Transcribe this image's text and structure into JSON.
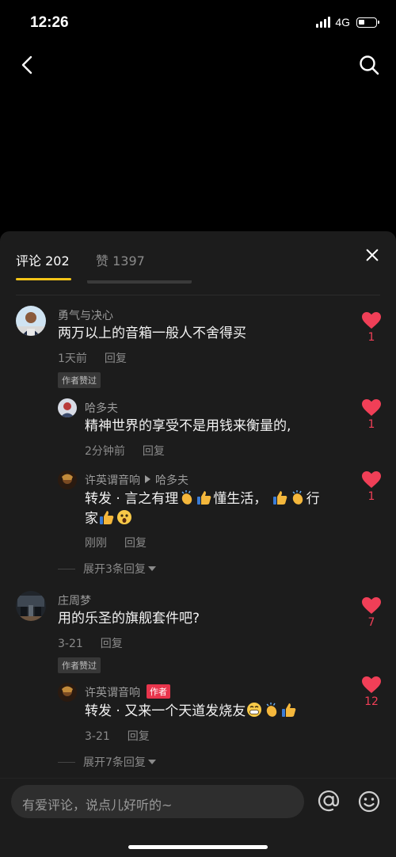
{
  "status_bar": {
    "time": "12:26",
    "network": "4G"
  },
  "panel": {
    "tabs": {
      "comments": "评论 202",
      "likes": "赞 1397"
    }
  },
  "comments": [
    {
      "user": "勇气与决心",
      "text": "两万以上的音箱一般人不舍得买",
      "time": "1天前",
      "reply": "回复",
      "badge": "作者赞过",
      "likes": "1",
      "replies": [
        {
          "user": "哈多夫",
          "text": "精神世界的享受不是用钱来衡量的,",
          "time": "2分钟前",
          "reply": "回复",
          "likes": "1"
        },
        {
          "user": "许英谓音响",
          "reply_to": "哈多夫",
          "text_a": "转发 · 言之有理",
          "text_b": "懂生活，",
          "text_c": "行",
          "text_d": "家",
          "time": "刚刚",
          "reply": "回复",
          "likes": "1"
        }
      ],
      "expand": "展开3条回复"
    },
    {
      "user": "庄周梦",
      "text": "用的乐圣的旗舰套件吧?",
      "time": "3-21",
      "reply": "回复",
      "badge": "作者赞过",
      "likes": "7",
      "replies": [
        {
          "user": "许英谓音响",
          "author_tag": "作者",
          "text": "转发 · 又来一个天道发烧友",
          "time": "3-21",
          "reply": "回复",
          "likes": "12"
        }
      ],
      "expand": "展开7条回复"
    }
  ],
  "input": {
    "placeholder": "有爱评论，说点儿好听的~"
  },
  "colors": {
    "accent": "#f5c518",
    "like": "#f03f57",
    "author_tag": "#e8354c",
    "panel_bg": "#1c1c1c"
  },
  "icons": [
    "back-icon",
    "search-icon",
    "close-icon",
    "heart-icon",
    "at-icon",
    "emoji-icon",
    "clap-emoji",
    "thumbs-up-emoji",
    "grin-emoji",
    "shocked-emoji"
  ]
}
